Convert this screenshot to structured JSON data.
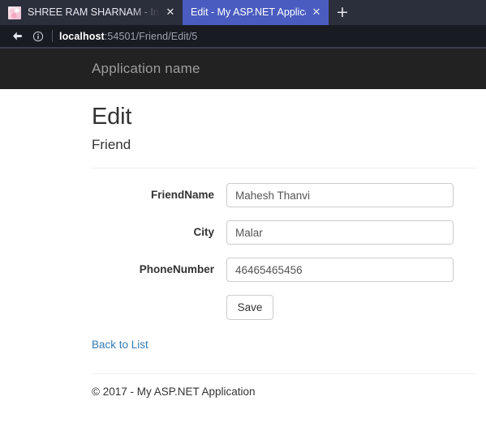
{
  "browser": {
    "tabs": [
      {
        "title": "SHREE RAM SHARNAM - Inte",
        "favicon": "site-favicon",
        "close_label": "✕",
        "active": false
      },
      {
        "title": "Edit - My ASP.NET Application",
        "close_label": "✕",
        "active": true
      }
    ],
    "new_tab_label": "+",
    "back_icon": "back-arrow-icon",
    "info_icon": "page-info-icon",
    "url": {
      "host": "localhost",
      "rest": ":54501/Friend/Edit/5"
    },
    "colors": {
      "tabstrip_bg": "#2b2e3b",
      "active_tab_bg": "#4a5cc0",
      "addressbar_bg": "#191b22"
    }
  },
  "page": {
    "navbar": {
      "brand": "Application name",
      "bg": "#222222",
      "brand_color": "#9d9d9d"
    },
    "title": "Edit",
    "subtitle": "Friend",
    "form": {
      "fields": [
        {
          "label": "FriendName",
          "value": "Mahesh Thanvi",
          "placeholder": ""
        },
        {
          "label": "City",
          "value": "Malar",
          "placeholder": ""
        },
        {
          "label": "PhoneNumber",
          "value": "46465465456",
          "placeholder": ""
        }
      ],
      "submit_label": "Save"
    },
    "back_link": "Back to List",
    "footer": "© 2017 - My ASP.NET Application",
    "link_color": "#337ab7"
  }
}
